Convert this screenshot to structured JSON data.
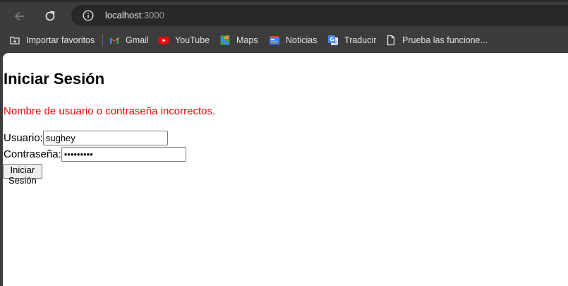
{
  "browser": {
    "url_host": "localhost",
    "url_port": ":3000",
    "bookmarks": [
      {
        "label": "Importar favoritos",
        "icon": "import-bookmarks-icon"
      },
      {
        "label": "Gmail",
        "icon": "gmail-icon"
      },
      {
        "label": "YouTube",
        "icon": "youtube-icon"
      },
      {
        "label": "Maps",
        "icon": "maps-icon"
      },
      {
        "label": "Noticias",
        "icon": "news-icon"
      },
      {
        "label": "Traducir",
        "icon": "translate-icon"
      },
      {
        "label": "Prueba las funcione...",
        "icon": "page-icon"
      }
    ]
  },
  "login": {
    "title": "Iniciar Sesión",
    "error": "Nombre de usuario o contraseña incorrectos.",
    "username_label": "Usuario:",
    "username_value": "sughey",
    "password_label": "Contraseña:",
    "password_value": "sughey123",
    "submit_label": "Iniciar Sesión"
  },
  "colors": {
    "error": "#ee0000",
    "chrome_bg": "#3c3c3c",
    "omnibox_bg": "#282828"
  }
}
